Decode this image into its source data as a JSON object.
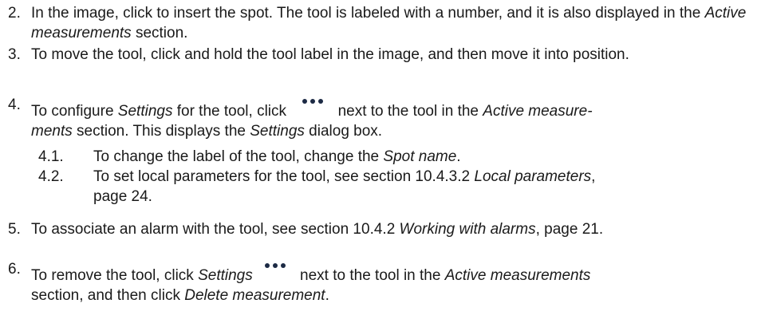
{
  "steps": [
    {
      "num": "2.",
      "parts": [
        "In the image, click to insert the spot. The tool is labeled with a number, and it is also displayed in the ",
        "Active measurements",
        " section."
      ]
    },
    {
      "num": "3.",
      "parts": [
        "To move the tool, click and hold the tool label in the image, and then move it into position."
      ]
    },
    {
      "num": "4.",
      "parts": [
        "To configure ",
        "Settings",
        " for the tool, click ",
        " next to the tool in the ",
        "Active measure-",
        "ments",
        " section. This displays the ",
        "Settings",
        " dialog box."
      ],
      "substeps": [
        {
          "num": "4.1.",
          "parts": [
            "To change the label of the tool, change the ",
            "Spot name",
            "."
          ]
        },
        {
          "num": "4.2.",
          "parts": [
            "To set local parameters for the tool, see section 10.4.3.2 ",
            "Local parameters",
            ",",
            "page 24."
          ]
        }
      ]
    },
    {
      "num": "5.",
      "parts": [
        "To associate an alarm with the tool, see section 10.4.2 ",
        "Working with alarms",
        ", page 21."
      ]
    },
    {
      "num": "6.",
      "parts": [
        "To remove the tool, click ",
        "Settings",
        " next to the tool in the ",
        "Active measurements",
        "section, and then click ",
        "Delete measurement",
        "."
      ]
    }
  ],
  "icons": {
    "settings": "more-dots-icon",
    "color": "#1c2a44"
  }
}
